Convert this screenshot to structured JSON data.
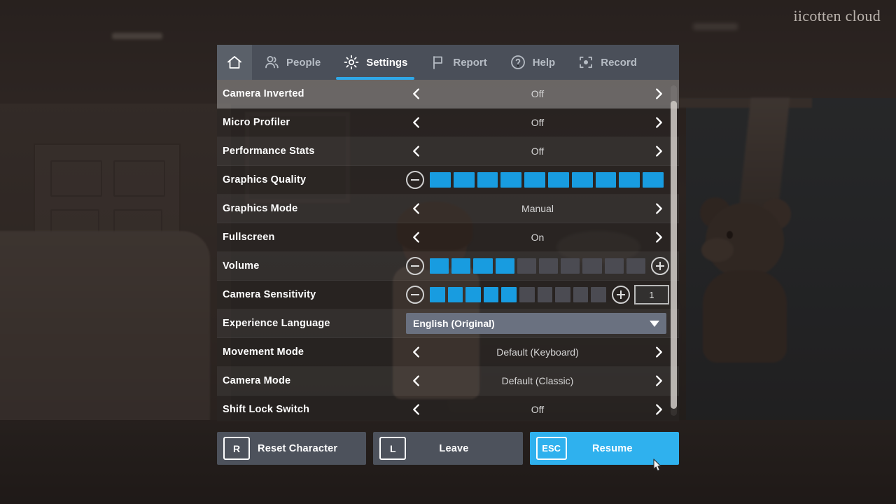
{
  "watermark": "iicotten cloud",
  "tabs": [
    {
      "id": "home",
      "label": "",
      "icon": "home-icon",
      "active": false
    },
    {
      "id": "people",
      "label": "People",
      "icon": "people-icon",
      "active": false
    },
    {
      "id": "settings",
      "label": "Settings",
      "icon": "gear-icon",
      "active": true
    },
    {
      "id": "report",
      "label": "Report",
      "icon": "flag-icon",
      "active": false
    },
    {
      "id": "help",
      "label": "Help",
      "icon": "question-icon",
      "active": false
    },
    {
      "id": "record",
      "label": "Record",
      "icon": "record-icon",
      "active": false
    }
  ],
  "settings": [
    {
      "name": "shift-lock-switch",
      "label": "Shift Lock Switch",
      "type": "stepper",
      "value": "Off"
    },
    {
      "name": "camera-mode",
      "label": "Camera Mode",
      "type": "stepper",
      "value": "Default (Classic)"
    },
    {
      "name": "movement-mode",
      "label": "Movement Mode",
      "type": "stepper",
      "value": "Default (Keyboard)"
    },
    {
      "name": "experience-language",
      "label": "Experience Language",
      "type": "dropdown",
      "value": "English (Original)"
    },
    {
      "name": "camera-sensitivity",
      "label": "Camera Sensitivity",
      "type": "slider",
      "filled": 5,
      "total": 10,
      "value": "1",
      "has_plus": true,
      "has_valuebox": true
    },
    {
      "name": "volume",
      "label": "Volume",
      "type": "slider",
      "filled": 4,
      "total": 10,
      "value": "",
      "has_plus": true,
      "has_valuebox": false
    },
    {
      "name": "fullscreen",
      "label": "Fullscreen",
      "type": "stepper",
      "value": "On"
    },
    {
      "name": "graphics-mode",
      "label": "Graphics Mode",
      "type": "stepper",
      "value": "Manual"
    },
    {
      "name": "graphics-quality",
      "label": "Graphics Quality",
      "type": "slider",
      "filled": 10,
      "total": 10,
      "value": "",
      "has_plus": false,
      "has_valuebox": false
    },
    {
      "name": "performance-stats",
      "label": "Performance Stats",
      "type": "stepper",
      "value": "Off"
    },
    {
      "name": "micro-profiler",
      "label": "Micro Profiler",
      "type": "stepper",
      "value": "Off"
    },
    {
      "name": "camera-inverted",
      "label": "Camera Inverted",
      "type": "stepper",
      "value": "Off",
      "highlight": true
    }
  ],
  "buttons": [
    {
      "name": "reset-character-button",
      "key": "R",
      "label": "Reset Character",
      "primary": false
    },
    {
      "name": "leave-button",
      "key": "L",
      "label": "Leave",
      "primary": false
    },
    {
      "name": "resume-button",
      "key": "ESC",
      "label": "Resume",
      "primary": true
    }
  ],
  "colors": {
    "accent": "#2fa8e8",
    "slider_fill": "#189ce0",
    "resume": "#2fb1ee",
    "tabbar": "#4a4f59",
    "dropdown": "#6a7180"
  }
}
